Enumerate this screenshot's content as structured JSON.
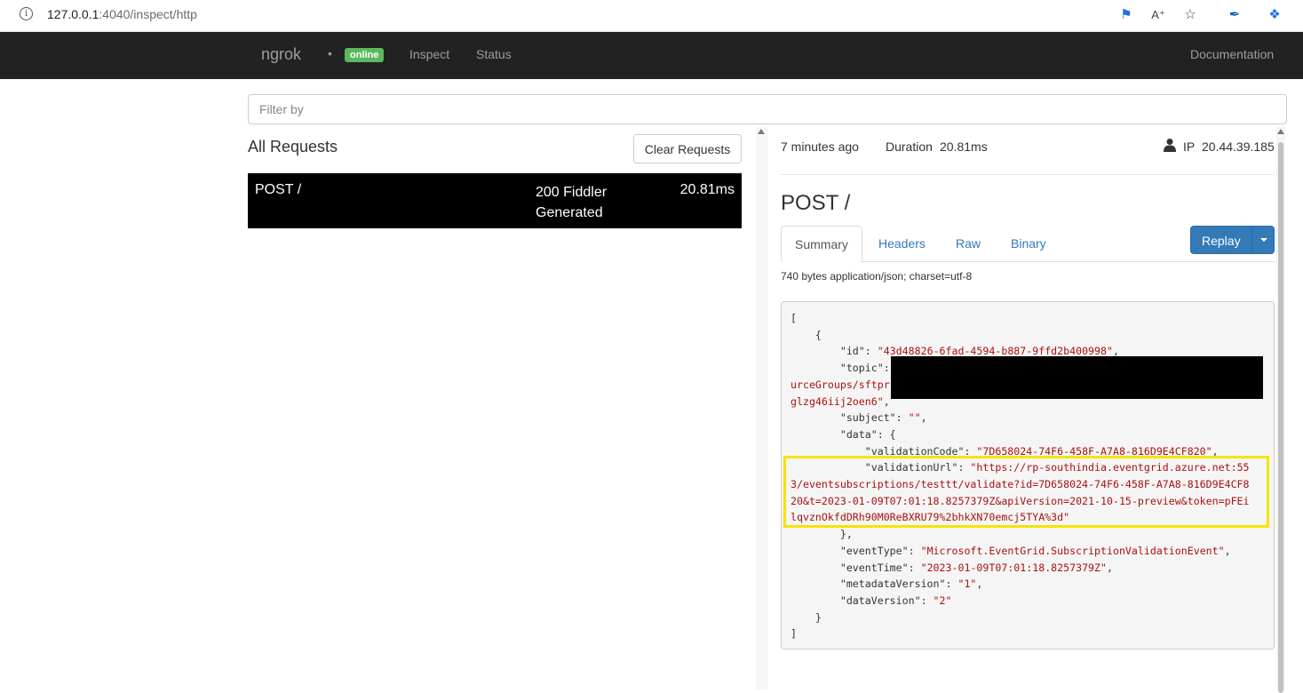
{
  "browser": {
    "url_host": "127.0.0.1",
    "url_rest": ":4040/inspect/http"
  },
  "nav": {
    "brand": "ngrok",
    "status_badge": "online",
    "links": [
      "Inspect",
      "Status"
    ],
    "documentation": "Documentation"
  },
  "filter": {
    "placeholder": "Filter by"
  },
  "requests": {
    "heading": "All Requests",
    "clear_label": "Clear Requests",
    "rows": [
      {
        "method_path": "POST /",
        "status_line1": "200 Fiddler",
        "status_line2": "Generated",
        "duration": "20.81ms"
      }
    ]
  },
  "detail": {
    "time_ago": "7 minutes ago",
    "duration_label": "Duration",
    "duration_value": "20.81ms",
    "ip_label": "IP",
    "ip_value": "20.44.39.185",
    "title": "POST /",
    "tabs": [
      "Summary",
      "Headers",
      "Raw",
      "Binary"
    ],
    "replay_label": "Replay",
    "content_info": "740 bytes application/json; charset=utf-8",
    "body": {
      "l1": "[",
      "l2": "    {",
      "id_key": "        \"id\": ",
      "id_val": "\"43d48826-6fad-4594-b887-9ffd2b400998\"",
      "topic_key": "        \"topic\":",
      "topic_l2": "urceGroups/sftpr",
      "topic_l3": "glzg46iij2oen6\"",
      "subject_key": "        \"subject\": ",
      "subject_val": "\"\"",
      "data_key": "        \"data\": {",
      "vcode_key": "            \"validationCode\": ",
      "vcode_val": "\"7D658024-74F6-458F-A7A8-816D9E4CF820\"",
      "vurl_key": "            \"validationUrl\": ",
      "vurl_l1": "\"https://rp-southindia.eventgrid.azure.net:55",
      "vurl_l2": "3/eventsubscriptions/testtt/validate?id=7D658024-74F6-458F-A7A8-816D9E4CF8",
      "vurl_l3": "20&t=2023-01-09T07:01:18.8257379Z&apiVersion=2021-10-15-preview&token=pFEi",
      "vurl_l4": "lqvznOkfdDRh90M0ReBXRU79%2bhkXN70emcj5TYA%3d\"",
      "data_close": "        },",
      "etype_key": "        \"eventType\": ",
      "etype_val": "\"Microsoft.EventGrid.SubscriptionValidationEvent\"",
      "etime_key": "        \"eventTime\": ",
      "etime_val": "\"2023-01-09T07:01:18.8257379Z\"",
      "mver_key": "        \"metadataVersion\": ",
      "mver_val": "\"1\"",
      "dver_key": "        \"dataVersion\": ",
      "dver_val": "\"2\"",
      "l_close_obj": "    }",
      "l_close_arr": "]"
    }
  },
  "colors": {
    "navbar": "#222222",
    "online": "#5cb85c",
    "link": "#337ab7",
    "highlight": "#f5e400"
  }
}
